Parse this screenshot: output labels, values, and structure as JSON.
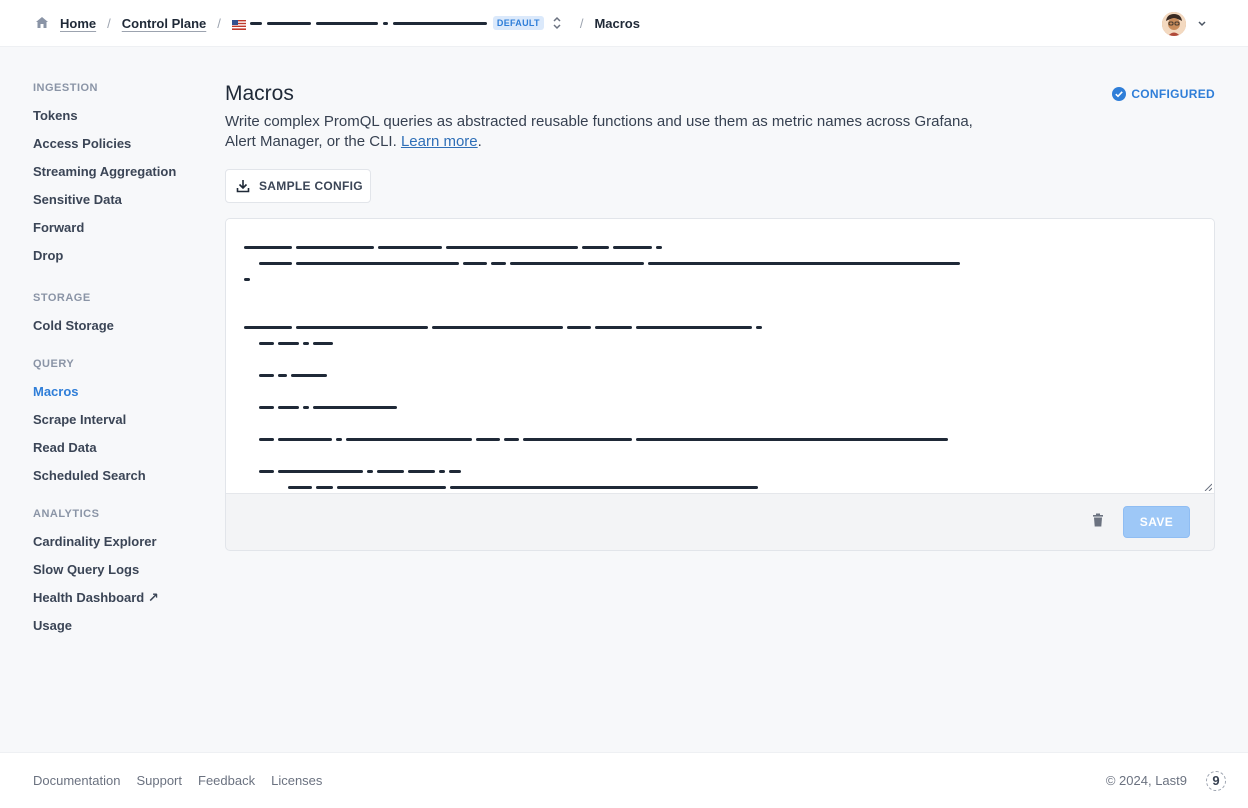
{
  "breadcrumb": {
    "home": "Home",
    "control_plane": "Control Plane",
    "env_badge": "DEFAULT",
    "current": "Macros"
  },
  "sidebar": {
    "sections": [
      {
        "title": "INGESTION",
        "items": [
          "Tokens",
          "Access Policies",
          "Streaming Aggregation",
          "Sensitive Data",
          "Forward",
          "Drop"
        ]
      },
      {
        "title": "STORAGE",
        "items": [
          "Cold Storage"
        ]
      },
      {
        "title": "QUERY",
        "items": [
          "Macros",
          "Scrape Interval",
          "Read Data",
          "Scheduled Search"
        ]
      },
      {
        "title": "ANALYTICS",
        "items": [
          "Cardinality Explorer",
          "Slow Query Logs",
          "Health Dashboard ↗",
          "Usage"
        ]
      }
    ],
    "active": "Macros"
  },
  "main": {
    "title": "Macros",
    "status": "CONFIGURED",
    "description": "Write complex PromQL queries as abstracted reusable functions and use them as metric names across Grafana, Alert Manager, or the CLI.",
    "learn_more": "Learn more",
    "description_end": ".",
    "sample_button": "SAMPLE CONFIG",
    "save_button": "SAVE"
  },
  "footer": {
    "links": [
      "Documentation",
      "Support",
      "Feedback",
      "Licenses"
    ],
    "copyright": "© 2024, Last9",
    "logo": "9"
  },
  "colors": {
    "accent": "#2f7ed8",
    "save_disabled": "#9ec8f7",
    "text": "#1f2937"
  },
  "icons": [
    "home-icon",
    "us-flag-icon",
    "up-down-icon",
    "chevron-down-icon",
    "check-circle-icon",
    "download-icon",
    "trash-icon",
    "resize-handle-icon"
  ]
}
